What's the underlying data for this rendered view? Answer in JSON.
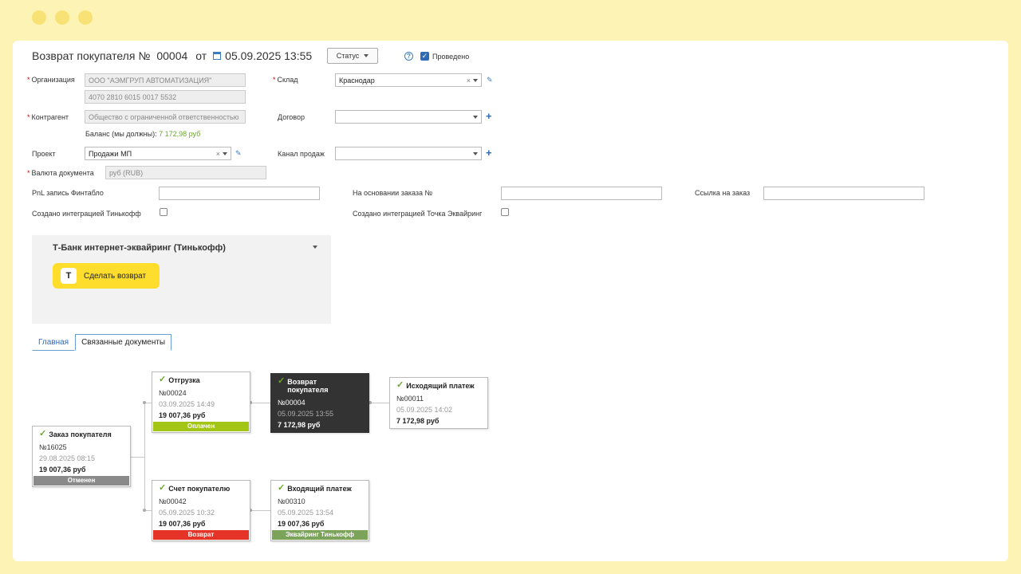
{
  "header": {
    "doc_title": "Возврат покупателя №",
    "doc_number": "00004",
    "date_prefix": "от",
    "date": "05.09.2025 13:55",
    "status_label": "Статус",
    "help_label": "?",
    "posted_label": "Проведено",
    "posted_checked": true
  },
  "form": {
    "org_label": "Организация",
    "org_value": "ООО \"АЭМГРУП АВТОМАТИЗАЦИЯ\"",
    "account_value": "4070 2810 6015 0017 5532",
    "warehouse_label": "Склад",
    "warehouse_value": "Краснодар",
    "counterparty_label": "Контрагент",
    "counterparty_value": "Общество с ограниченной ответственностью",
    "contract_label": "Договор",
    "contract_value": "",
    "balance_label": "Баланс (мы должны):",
    "balance_value": "7 172,98 руб",
    "project_label": "Проект",
    "project_value": "Продажи МП",
    "channel_label": "Канал продаж",
    "channel_value": "",
    "currency_label": "Валюта документа",
    "currency_value": "руб (RUB)",
    "pnl_label": "PnL запись Финтабло",
    "pnl_value": "",
    "order_basis_label": "На основании заказа №",
    "order_basis_value": "",
    "order_link_label": "Ссылка на заказ",
    "order_link_value": "",
    "tinkoff_integration_label": "Создано интеграцией Тинькофф",
    "tochka_integration_label": "Создано интеграцией Точка Эквайринг"
  },
  "tbank": {
    "title": "Т-Банк интернет-эквайринг (Тинькофф)",
    "logo_letter": "Т",
    "refund_button": "Сделать возврат"
  },
  "tabs": [
    {
      "label": "Главная"
    },
    {
      "label": "Связанные документы"
    }
  ],
  "colors": {
    "accent_blue": "#2d6bb5",
    "green": "#6aa82a",
    "paid": "#a3c515",
    "cancelled": "#8a8a8a",
    "refund": "#e53327",
    "acquiring": "#7ba35a",
    "dark_card": "#333333",
    "tbank_yellow": "#ffdd2d"
  },
  "docs": {
    "customer_order": {
      "title": "Заказ покупателя",
      "number": "№16025",
      "date": "29.08.2025 08:15",
      "sum": "19 007,36 руб",
      "status": "Отменен"
    },
    "shipment": {
      "title": "Отгрузка",
      "number": "№00024",
      "date": "03.09.2025 14:49",
      "sum": "19 007,36 руб",
      "status": "Оплачен"
    },
    "invoice": {
      "title": "Счет покупателю",
      "number": "№00042",
      "date": "05.09.2025 10:32",
      "sum": "19 007,36 руб",
      "status": "Возврат"
    },
    "customer_return": {
      "title": "Возврат покупателя",
      "number": "№00004",
      "date": "05.09.2025 13:55",
      "sum": "7 172,98 руб"
    },
    "incoming_payment": {
      "title": "Входящий платеж",
      "number": "№00310",
      "date": "05.09.2025 13:54",
      "sum": "19 007,36 руб",
      "status": "Эквайринг Тинькофф"
    },
    "outgoing_payment": {
      "title": "Исходящий платеж",
      "number": "№00011",
      "date": "05.09.2025 14:02",
      "sum": "7 172,98 руб"
    }
  }
}
